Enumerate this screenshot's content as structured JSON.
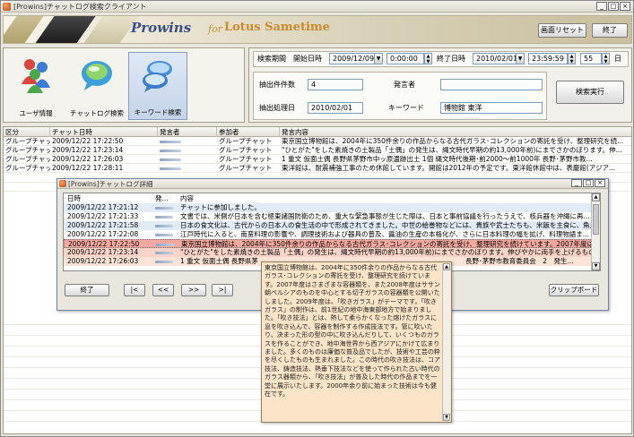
{
  "window": {
    "title": "[Prowins]チャットログ検索クライアント",
    "controls": [
      "_",
      "□",
      "×"
    ]
  },
  "banner": {
    "brand": "Prowins",
    "for": "for",
    "product": "Lotus Sametime",
    "reset_button": "画面リセット",
    "exit_button": "終了"
  },
  "tiles": [
    {
      "label": "ユーザ情報",
      "icon": "users-icon"
    },
    {
      "label": "チャットログ検索",
      "icon": "chat-bubble-icon"
    },
    {
      "label": "キーワード検索",
      "icon": "keyword-bubbles-icon"
    }
  ],
  "search": {
    "period_label": "検索期間",
    "start_label": "開始日時",
    "start_date": "2009/12/09",
    "start_time": "0:00:00",
    "end_label": "終了日時",
    "end_date": "2010/02/01",
    "end_time": "23:59:59",
    "days_value": "55",
    "days_unit": "日",
    "count_label": "抽出件件数",
    "count_value": "4",
    "speaker_label": "発言者",
    "speaker_value": "",
    "processed_label": "抽出処理日",
    "processed_value": "2010/02/01",
    "keyword_label": "キーワード",
    "keyword_value": "博物館 東洋",
    "run_button": "検索実行"
  },
  "grid": {
    "headers": [
      "区分",
      "チャット日時",
      "発言者",
      "参加者",
      "発言内容"
    ],
    "rows": [
      {
        "kind": "グループチャット",
        "datetime": "2009/12/22 17:22:50",
        "participants": "グループチャット",
        "content": "東京国立博物館は、2004年に350件余りの作品からなる古代ガラス･コレクションの寄託を受け、整理研究を続..."
      },
      {
        "kind": "グループチャット",
        "datetime": "2009/12/22 17:23:14",
        "participants": "グループチャット",
        "content": "\"ひとがた\"をした素焼きの土製品「土偶」の発生は、縄文時代早期の約13,000年前)にまでさかのぼります。伸..."
      },
      {
        "kind": "グループチャット",
        "datetime": "2009/12/22 17:26:03",
        "participants": "グループチャット",
        "content": "1 重文 仮面土偶 長野県茅野市中ッ原遺跡出土 1個 縄文時代後期･前2000～前1000年 長野･茅野市教..."
      },
      {
        "kind": "グループチャット",
        "datetime": "2009/12/22 17:28:11",
        "participants": "グループチャット",
        "content": "東洋館は、耐震補強工事のため休館しています。開館は2012年の予定です。東洋館休館中は、表慶館(アジア..."
      }
    ]
  },
  "detail": {
    "title": "[Prowins]チャットログ詳細",
    "headers": [
      "日時",
      "発...",
      "内容"
    ],
    "rows": [
      {
        "datetime": "2009/12/22 17:21:12",
        "content": "チャットに参加しました。",
        "highlight": "none"
      },
      {
        "datetime": "2009/12/22 17:21:33",
        "content": "文書では、米側が日本を含む極東諸国防衛のため、重大な緊急事態が生じた際は、日本と事前協議を行ったうえで、核兵器を沖縄に再...",
        "highlight": "none"
      },
      {
        "datetime": "2009/12/22 17:21:58",
        "content": "日本の食文化は、古代からの日本人の食生活の中で形成されてきました。中世の絵巻物などには、貴族や武士たちも、米飯を主食に、魚貝...",
        "highlight": "none"
      },
      {
        "datetime": "2009/12/22 17:22:08",
        "content": "江戸時代に入ると、南蛮料理の影響や、調理技術および器具の普及、醤油の生産の本格化が、さらに日本料理の幅を拡げ、料理物語ま...",
        "highlight": "none"
      },
      {
        "datetime": "2009/12/22 17:22:50",
        "content": "東京国立博物館は、2004年に350件余りの作品からなる古代ガラス･コレクションの寄託を受け、整理研究を続けています。2007年度はさま...",
        "highlight": "strong"
      },
      {
        "datetime": "2009/12/22 17:23:14",
        "content": "\"ひとがた\"をした素焼きの土製品「土偶」の発生は、縄文時代早期の約13,000年前)にまでさかのぼります。伸びやかに両手を上げるもの、...",
        "highlight": "light"
      },
      {
        "datetime": "2009/12/22 17:26:03",
        "content": "1 重文 仮面土偶 長野県茅",
        "tail": "長野･茅野市教育委員会　2　発生...",
        "highlight": "light"
      }
    ],
    "close_button": "終了",
    "nav_buttons": [
      "|<",
      "<<",
      ">>",
      ">|"
    ],
    "clipboard_button": "クリップボード"
  },
  "popup": {
    "text": "東京国立博物館は、2004年に350件余りの作品からなる古代ガラス･コレクションの寄託を受け、整理研究を続けています。2007年度はさまざまな容器類を、また2008年度はササン朝ペルシアのものを中心とする切子ガラスの容器類を公開いたしました。2009年度は、「吹きガラス」がテーマです。「吹きガラス」の制作は、前1世紀の地中海東部地方で始まりました。「吹き技法」とは、熱して柔らかくなった熔けたガラスに息を吹き込んで、容器を制作する作成技法です。管に吹いたり、決まった形の型の中に吹き込んだりして、いくつものガラスを作ることができ、地中海世界から西アジアにかけて広まりました。多くのものは廉価な普及品でしたが、技術や工芸の粋を尽くしたものも生まれました。この時代の吹き技法は、コア技法、鋳造技法、熱垂下技法などを使って作られた古い時代のガラス器類から、「吹き技法」が普及した時代の作品までを一堂に展示いたします。2000年余り前に始まった技術は今も健在です。"
  }
}
